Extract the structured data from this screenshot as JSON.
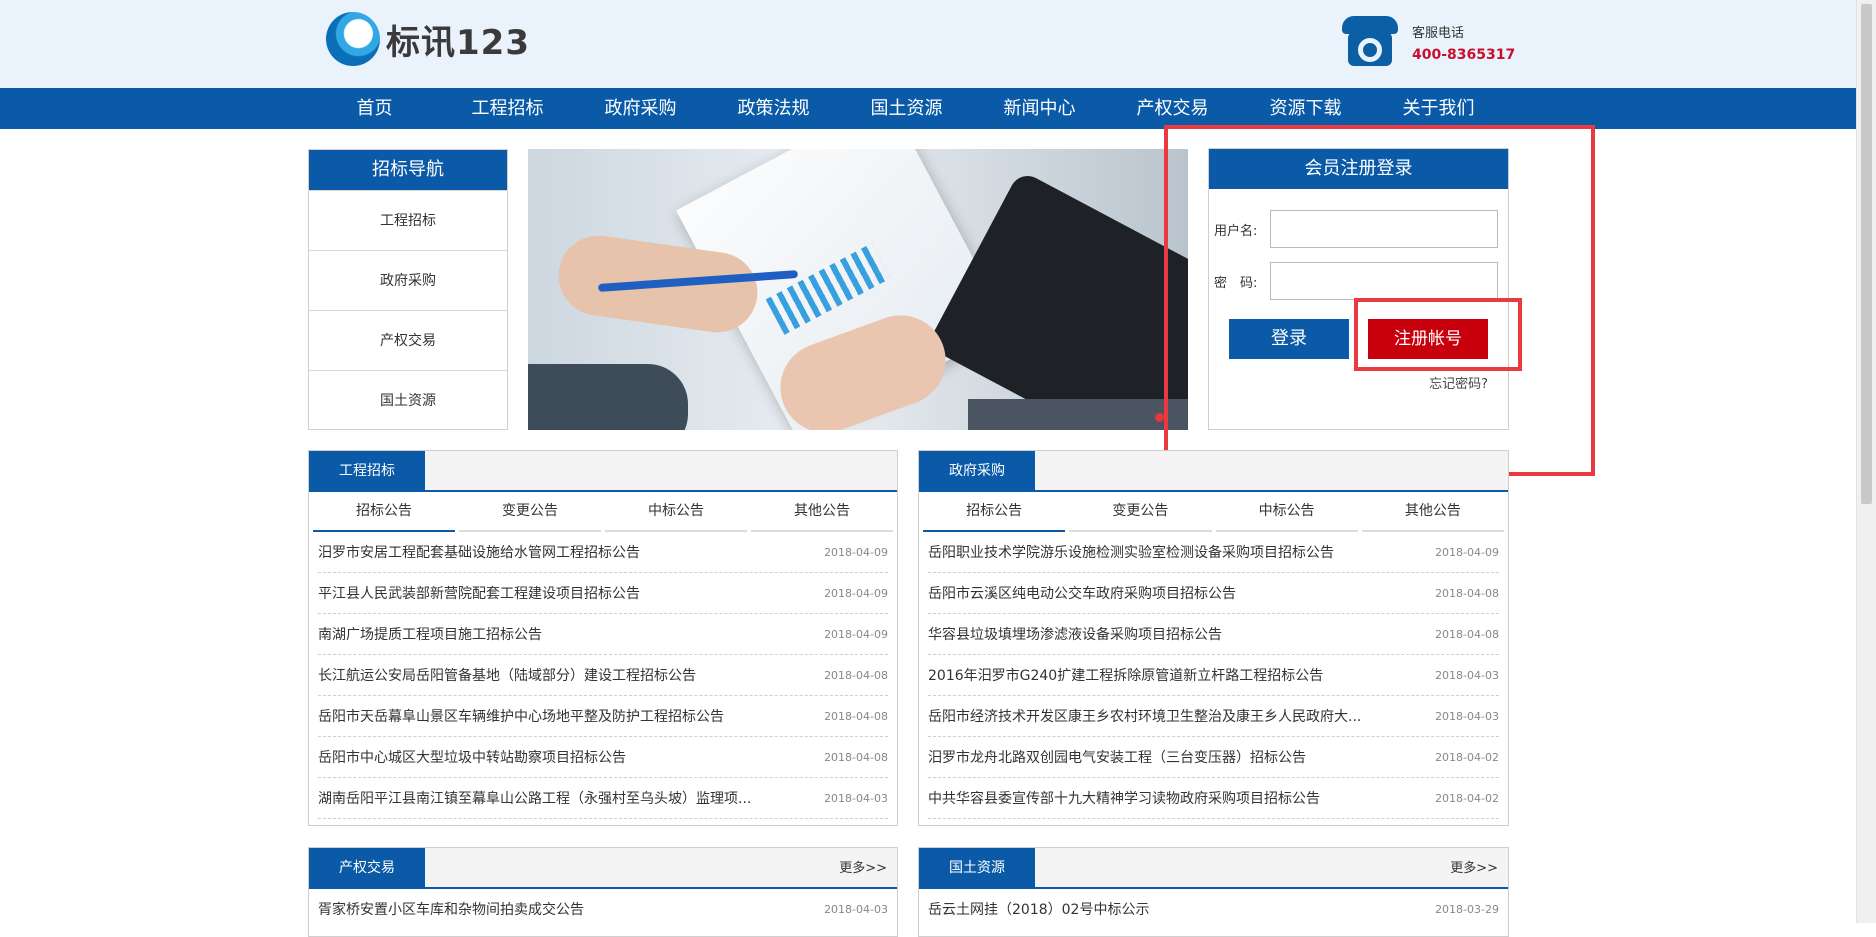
{
  "logo": {
    "text": "标讯123"
  },
  "hotline": {
    "label": "客服电话",
    "number": "400-8365317"
  },
  "nav": [
    "首页",
    "工程招标",
    "政府采购",
    "政策法规",
    "国土资源",
    "新闻中心",
    "产权交易",
    "资源下载",
    "关于我们"
  ],
  "sidenav": {
    "title": "招标导航",
    "items": [
      "工程招标",
      "政府采购",
      "产权交易",
      "国土资源"
    ]
  },
  "login": {
    "title": "会员注册登录",
    "username_label": "用户名:",
    "password_label": "密　码:",
    "login_button": "登录",
    "register_button": "注册帐号",
    "forgot": "忘记密码?"
  },
  "tabs": [
    "招标公告",
    "变更公告",
    "中标公告",
    "其他公告"
  ],
  "engineering": {
    "title": "工程招标",
    "rows": [
      {
        "title": "汨罗市安居工程配套基础设施给水管网工程招标公告",
        "date": "2018-04-09"
      },
      {
        "title": "平江县人民武装部新营院配套工程建设项目招标公告",
        "date": "2018-04-09"
      },
      {
        "title": "南湖广场提质工程项目施工招标公告",
        "date": "2018-04-09"
      },
      {
        "title": "长江航运公安局岳阳管备基地（陆域部分）建设工程招标公告",
        "date": "2018-04-08"
      },
      {
        "title": "岳阳市天岳幕阜山景区车辆维护中心场地平整及防护工程招标公告",
        "date": "2018-04-08"
      },
      {
        "title": "岳阳市中心城区大型垃圾中转站勘察项目招标公告",
        "date": "2018-04-08"
      },
      {
        "title": "湖南岳阳平江县南江镇至幕阜山公路工程（永强村至乌头坡）监理项...",
        "date": "2018-04-03"
      }
    ]
  },
  "procurement": {
    "title": "政府采购",
    "rows": [
      {
        "title": "岳阳职业技术学院游乐设施检测实验室检测设备采购项目招标公告",
        "date": "2018-04-09"
      },
      {
        "title": "岳阳市云溪区纯电动公交车政府采购项目招标公告",
        "date": "2018-04-08"
      },
      {
        "title": "华容县垃圾填埋场渗滤液设备采购项目招标公告",
        "date": "2018-04-08"
      },
      {
        "title": "2016年汨罗市G240扩建工程拆除原管道新立杆路工程招标公告",
        "date": "2018-04-03"
      },
      {
        "title": "岳阳市经济技术开发区康王乡农村环境卫生整治及康王乡人民政府大...",
        "date": "2018-04-03"
      },
      {
        "title": "汨罗市龙舟北路双创园电气安装工程（三台变压器）招标公告",
        "date": "2018-04-02"
      },
      {
        "title": "中共华容县委宣传部十九大精神学习读物政府采购项目招标公告",
        "date": "2018-04-02"
      }
    ]
  },
  "property": {
    "title": "产权交易",
    "more": "更多>>",
    "rows": [
      {
        "title": "胥家桥安置小区车库和杂物间拍卖成交公告",
        "date": "2018-04-03"
      }
    ]
  },
  "land": {
    "title": "国土资源",
    "more": "更多>>",
    "rows": [
      {
        "title": "岳云土网挂（2018）02号中标公示",
        "date": "2018-03-29"
      }
    ]
  }
}
